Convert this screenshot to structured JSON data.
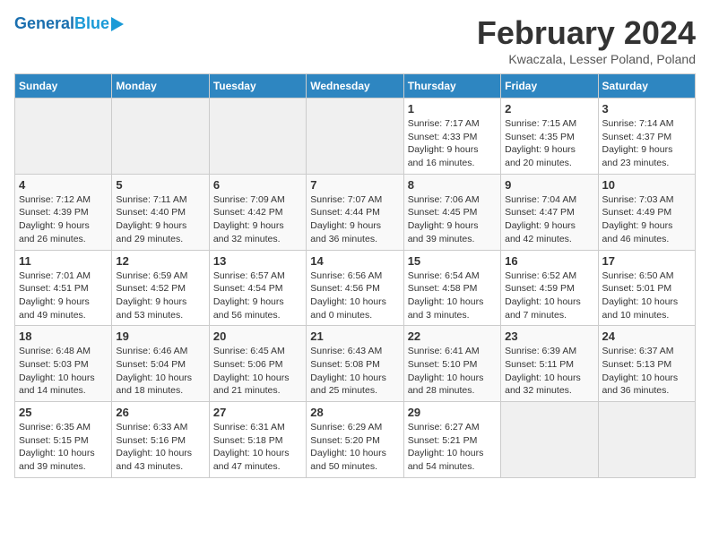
{
  "header": {
    "logo_general": "General",
    "logo_blue": "Blue",
    "title": "February 2024",
    "subtitle": "Kwaczala, Lesser Poland, Poland"
  },
  "days_of_week": [
    "Sunday",
    "Monday",
    "Tuesday",
    "Wednesday",
    "Thursday",
    "Friday",
    "Saturday"
  ],
  "weeks": [
    [
      {
        "day": "",
        "info": ""
      },
      {
        "day": "",
        "info": ""
      },
      {
        "day": "",
        "info": ""
      },
      {
        "day": "",
        "info": ""
      },
      {
        "day": "1",
        "info": "Sunrise: 7:17 AM\nSunset: 4:33 PM\nDaylight: 9 hours\nand 16 minutes."
      },
      {
        "day": "2",
        "info": "Sunrise: 7:15 AM\nSunset: 4:35 PM\nDaylight: 9 hours\nand 20 minutes."
      },
      {
        "day": "3",
        "info": "Sunrise: 7:14 AM\nSunset: 4:37 PM\nDaylight: 9 hours\nand 23 minutes."
      }
    ],
    [
      {
        "day": "4",
        "info": "Sunrise: 7:12 AM\nSunset: 4:39 PM\nDaylight: 9 hours\nand 26 minutes."
      },
      {
        "day": "5",
        "info": "Sunrise: 7:11 AM\nSunset: 4:40 PM\nDaylight: 9 hours\nand 29 minutes."
      },
      {
        "day": "6",
        "info": "Sunrise: 7:09 AM\nSunset: 4:42 PM\nDaylight: 9 hours\nand 32 minutes."
      },
      {
        "day": "7",
        "info": "Sunrise: 7:07 AM\nSunset: 4:44 PM\nDaylight: 9 hours\nand 36 minutes."
      },
      {
        "day": "8",
        "info": "Sunrise: 7:06 AM\nSunset: 4:45 PM\nDaylight: 9 hours\nand 39 minutes."
      },
      {
        "day": "9",
        "info": "Sunrise: 7:04 AM\nSunset: 4:47 PM\nDaylight: 9 hours\nand 42 minutes."
      },
      {
        "day": "10",
        "info": "Sunrise: 7:03 AM\nSunset: 4:49 PM\nDaylight: 9 hours\nand 46 minutes."
      }
    ],
    [
      {
        "day": "11",
        "info": "Sunrise: 7:01 AM\nSunset: 4:51 PM\nDaylight: 9 hours\nand 49 minutes."
      },
      {
        "day": "12",
        "info": "Sunrise: 6:59 AM\nSunset: 4:52 PM\nDaylight: 9 hours\nand 53 minutes."
      },
      {
        "day": "13",
        "info": "Sunrise: 6:57 AM\nSunset: 4:54 PM\nDaylight: 9 hours\nand 56 minutes."
      },
      {
        "day": "14",
        "info": "Sunrise: 6:56 AM\nSunset: 4:56 PM\nDaylight: 10 hours\nand 0 minutes."
      },
      {
        "day": "15",
        "info": "Sunrise: 6:54 AM\nSunset: 4:58 PM\nDaylight: 10 hours\nand 3 minutes."
      },
      {
        "day": "16",
        "info": "Sunrise: 6:52 AM\nSunset: 4:59 PM\nDaylight: 10 hours\nand 7 minutes."
      },
      {
        "day": "17",
        "info": "Sunrise: 6:50 AM\nSunset: 5:01 PM\nDaylight: 10 hours\nand 10 minutes."
      }
    ],
    [
      {
        "day": "18",
        "info": "Sunrise: 6:48 AM\nSunset: 5:03 PM\nDaylight: 10 hours\nand 14 minutes."
      },
      {
        "day": "19",
        "info": "Sunrise: 6:46 AM\nSunset: 5:04 PM\nDaylight: 10 hours\nand 18 minutes."
      },
      {
        "day": "20",
        "info": "Sunrise: 6:45 AM\nSunset: 5:06 PM\nDaylight: 10 hours\nand 21 minutes."
      },
      {
        "day": "21",
        "info": "Sunrise: 6:43 AM\nSunset: 5:08 PM\nDaylight: 10 hours\nand 25 minutes."
      },
      {
        "day": "22",
        "info": "Sunrise: 6:41 AM\nSunset: 5:10 PM\nDaylight: 10 hours\nand 28 minutes."
      },
      {
        "day": "23",
        "info": "Sunrise: 6:39 AM\nSunset: 5:11 PM\nDaylight: 10 hours\nand 32 minutes."
      },
      {
        "day": "24",
        "info": "Sunrise: 6:37 AM\nSunset: 5:13 PM\nDaylight: 10 hours\nand 36 minutes."
      }
    ],
    [
      {
        "day": "25",
        "info": "Sunrise: 6:35 AM\nSunset: 5:15 PM\nDaylight: 10 hours\nand 39 minutes."
      },
      {
        "day": "26",
        "info": "Sunrise: 6:33 AM\nSunset: 5:16 PM\nDaylight: 10 hours\nand 43 minutes."
      },
      {
        "day": "27",
        "info": "Sunrise: 6:31 AM\nSunset: 5:18 PM\nDaylight: 10 hours\nand 47 minutes."
      },
      {
        "day": "28",
        "info": "Sunrise: 6:29 AM\nSunset: 5:20 PM\nDaylight: 10 hours\nand 50 minutes."
      },
      {
        "day": "29",
        "info": "Sunrise: 6:27 AM\nSunset: 5:21 PM\nDaylight: 10 hours\nand 54 minutes."
      },
      {
        "day": "",
        "info": ""
      },
      {
        "day": "",
        "info": ""
      }
    ]
  ]
}
